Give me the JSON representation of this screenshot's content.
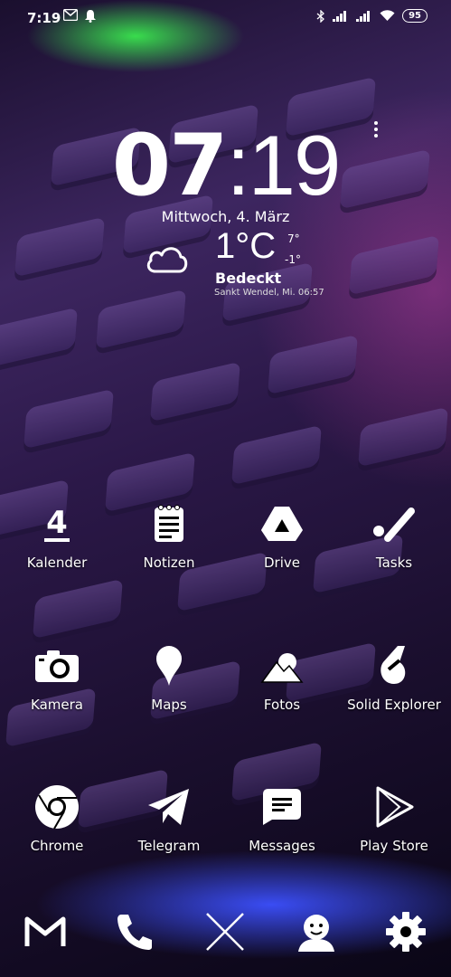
{
  "status_bar": {
    "time": "7:19",
    "left_icons": [
      "gmail-icon",
      "bell-icon"
    ],
    "right_icons": [
      "bluetooth-icon",
      "signal-icon",
      "signal-icon",
      "wifi-icon"
    ],
    "battery": "95"
  },
  "clock_widget": {
    "hours": "07",
    "minutes": ":19",
    "date": "Mittwoch, 4. März",
    "temperature": "1°C",
    "temp_max": "7°",
    "temp_min": "-1°",
    "condition": "Bedeckt",
    "location_time": "Sankt Wendel, Mi. 06:57",
    "weather_icon": "cloud-icon"
  },
  "apps": [
    {
      "label": "Kalender",
      "icon": "calendar-icon"
    },
    {
      "label": "Notizen",
      "icon": "notepad-icon"
    },
    {
      "label": "Drive",
      "icon": "drive-icon"
    },
    {
      "label": "Tasks",
      "icon": "tasks-icon"
    },
    {
      "label": "Kamera",
      "icon": "camera-icon"
    },
    {
      "label": "Maps",
      "icon": "map-pin-icon"
    },
    {
      "label": "Fotos",
      "icon": "photos-icon"
    },
    {
      "label": "Solid Explorer",
      "icon": "solid-explorer-icon"
    },
    {
      "label": "Chrome",
      "icon": "chrome-icon"
    },
    {
      "label": "Telegram",
      "icon": "telegram-icon"
    },
    {
      "label": "Messages",
      "icon": "messages-icon"
    },
    {
      "label": "Play Store",
      "icon": "play-store-icon"
    }
  ],
  "dock": [
    "gmail-icon",
    "phone-icon",
    "x-icon",
    "avatar-icon",
    "gear-icon"
  ],
  "calendar_day": "4"
}
